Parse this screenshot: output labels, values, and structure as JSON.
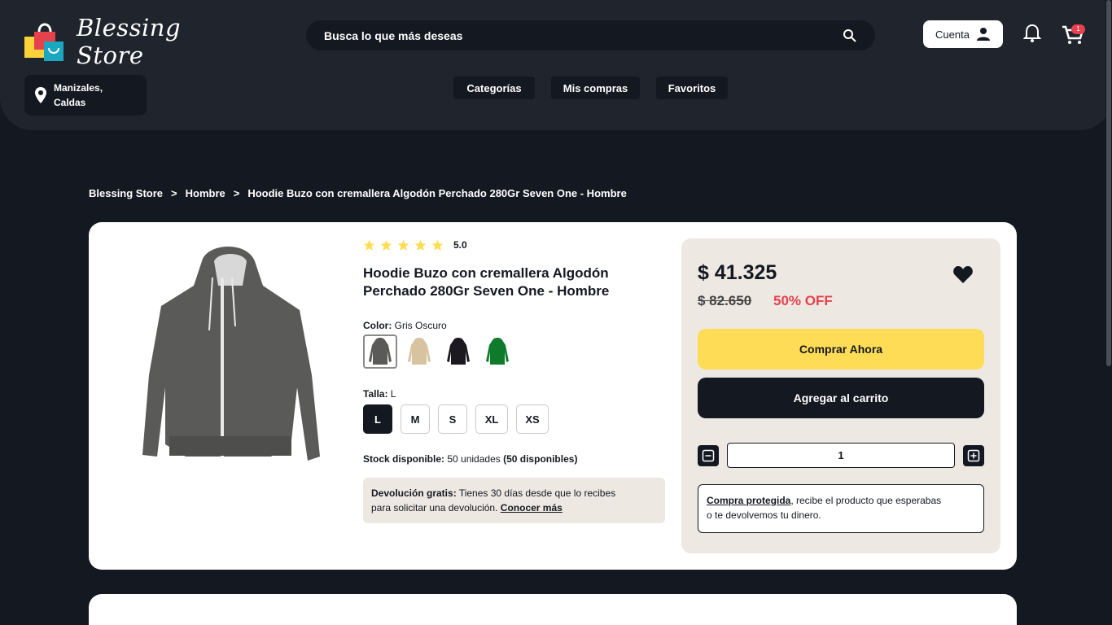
{
  "header": {
    "brand": "Blessing Store",
    "search_placeholder": "Busca lo que más deseas",
    "account_label": "Cuenta",
    "cart_count": "1",
    "location_line1": "Manizales,",
    "location_line2": "Caldas",
    "nav": [
      "Categorías",
      "Mis compras",
      "Favoritos"
    ]
  },
  "breadcrumb": [
    "Blessing Store",
    "Hombre",
    "Hoodie Buzo con cremallera Algodón Perchado 280Gr Seven One - Hombre"
  ],
  "breadcrumb_sep": ">",
  "product": {
    "rating": 5,
    "rating_label": "5.0",
    "title_line1": "Hoodie Buzo con cremallera Algodón",
    "title_line2": "Perchado 280Gr Seven One - Hombre",
    "color_label": "Color:",
    "color_value": "Gris Oscuro",
    "swatch_colors": [
      "#5a5a58",
      "#d8c3a0",
      "#1c1a20",
      "#0e7a2a"
    ],
    "size_label": "Talla:",
    "size_value": "L",
    "sizes": [
      "L",
      "M",
      "S",
      "XL",
      "XS"
    ],
    "stock_label": "Stock disponible:",
    "stock_units": "50 unidades",
    "stock_available": "(50 disponibles)",
    "return_label": "Devolución gratis:",
    "return_text": "Tienes 30 días desde que lo recibes",
    "return_text2": "para solicitar una devolución.",
    "return_link": "Conocer más"
  },
  "buy": {
    "price": "$ 41.325",
    "old_price": "$ 82.650",
    "discount": "50% OFF",
    "buy_now": "Comprar Ahora",
    "add_to_cart": "Agregar al carrito",
    "quantity": "1",
    "protected_link": "Compra protegida",
    "protected_text": ", recibe el producto que esperabas",
    "protected_text2": "o te devolvemos tu dinero."
  },
  "colors": {
    "background": "#141821",
    "header": "#20242d",
    "accent_yellow": "#fedc56",
    "discount_red": "#e5424d",
    "panel_beige": "#ede8e2"
  }
}
